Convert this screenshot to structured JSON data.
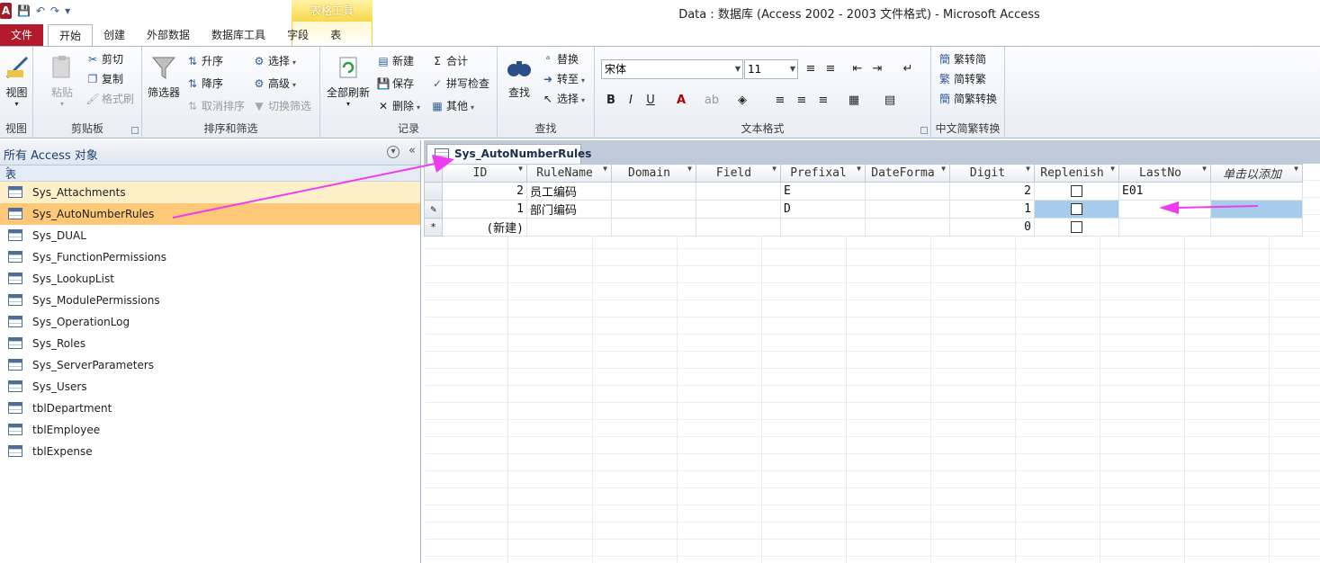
{
  "window": {
    "title": "Data : 数据库 (Access 2002 - 2003 文件格式) - Microsoft Access",
    "app_icon_letter": "A",
    "context_tab_header": "表格工具"
  },
  "ribbon_tabs": [
    "文件",
    "开始",
    "创建",
    "外部数据",
    "数据库工具",
    "字段",
    "表"
  ],
  "ribbon": {
    "views": {
      "view": "视图",
      "label": "视图"
    },
    "clipboard": {
      "paste": "粘贴",
      "cut": "剪切",
      "copy": "复制",
      "format_painter": "格式刷",
      "label": "剪贴板"
    },
    "sort_filter": {
      "filter": "筛选器",
      "ascending": "升序",
      "descending": "降序",
      "remove_sort": "取消排序",
      "selection": "选择",
      "advanced": "高级",
      "toggle_filter": "切换筛选",
      "label": "排序和筛选"
    },
    "records": {
      "refresh_all": "全部刷新",
      "new": "新建",
      "save": "保存",
      "delete": "删除",
      "totals": "合计",
      "spelling": "拼写检查",
      "more": "其他",
      "label": "记录"
    },
    "find": {
      "find": "查找",
      "replace": "替换",
      "goto": "转至",
      "select": "选择",
      "label": "查找"
    },
    "text_formatting": {
      "font": "宋体",
      "size": "11",
      "bold": "B",
      "italic": "I",
      "underline": "U",
      "label": "文本格式"
    },
    "chinese_conversion": {
      "trad_to_simp": "繁转简",
      "simp_to_trad": "简转繁",
      "convert": "简繁转换",
      "label": "中文简繁转换"
    }
  },
  "nav": {
    "title": "所有 Access 对象",
    "section": "表",
    "items": [
      "Sys_Attachments",
      "Sys_AutoNumberRules",
      "Sys_DUAL",
      "Sys_FunctionPermissions",
      "Sys_LookupList",
      "Sys_ModulePermissions",
      "Sys_OperationLog",
      "Sys_Roles",
      "Sys_ServerParameters",
      "Sys_Users",
      "tblDepartment",
      "tblEmployee",
      "tblExpense"
    ]
  },
  "document": {
    "tab_title": "Sys_AutoNumberRules",
    "columns": [
      "ID",
      "RuleName",
      "Domain",
      "Field",
      "Prefixal",
      "DateForma",
      "Digit",
      "Replenish",
      "LastNo",
      "单击以添加"
    ],
    "rows": [
      {
        "selector": "",
        "ID": "2",
        "RuleName": "员工编码",
        "Domain": "",
        "Field": "",
        "Prefixal": "E",
        "DateForma": "",
        "Digit": "2",
        "LastNo": "E01"
      },
      {
        "selector": "✎",
        "ID": "1",
        "RuleName": "部门编码",
        "Domain": "",
        "Field": "",
        "Prefixal": "D",
        "DateForma": "",
        "Digit": "1",
        "LastNo": ""
      },
      {
        "selector": "*",
        "ID": "(新建)",
        "RuleName": "",
        "Domain": "",
        "Field": "",
        "Prefixal": "",
        "DateForma": "",
        "Digit": "0",
        "LastNo": ""
      }
    ]
  },
  "colors": {
    "file_tab": "#b5192c",
    "selected_item": "#fdc878",
    "hover_item": "#fdf0c8",
    "cell_highlight": "#a7cbeb",
    "annotation_arrow": "#f03cf0"
  }
}
